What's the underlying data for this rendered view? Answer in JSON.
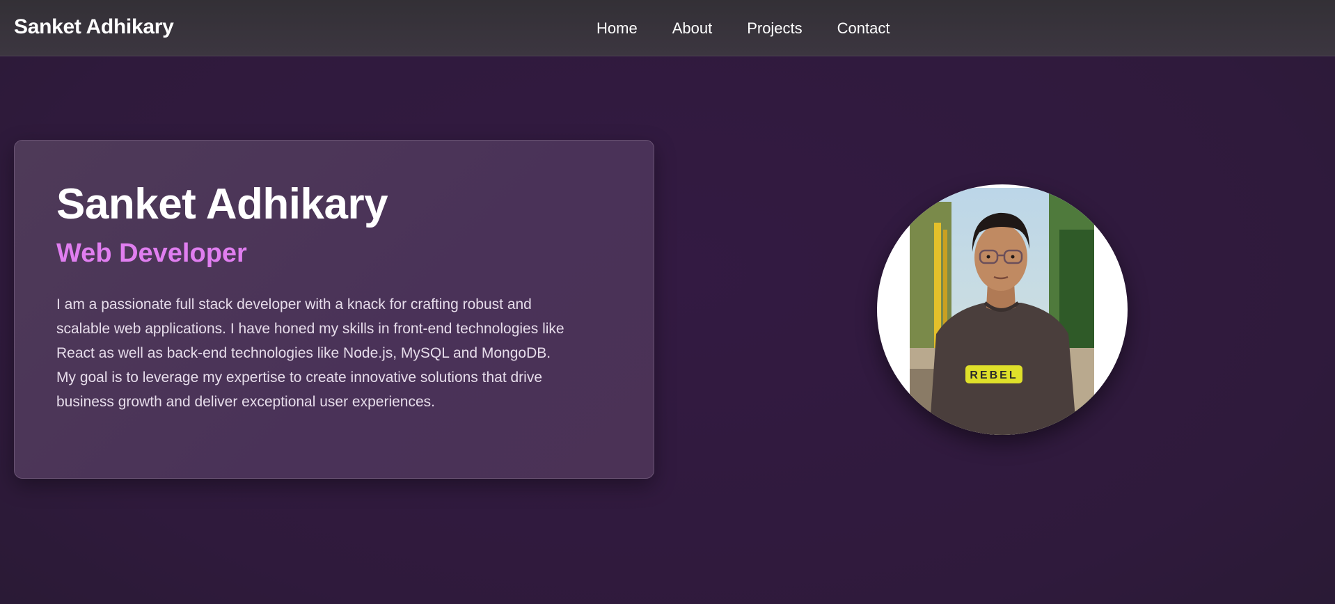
{
  "navbar": {
    "brand": "Sanket Adhikary",
    "links": [
      {
        "label": "Home"
      },
      {
        "label": "About"
      },
      {
        "label": "Projects"
      },
      {
        "label": "Contact"
      }
    ]
  },
  "hero": {
    "name": "Sanket Adhikary",
    "role": "Web Developer",
    "bio": "I am a passionate full stack developer with a knack for crafting robust and scalable web applications. I have honed my skills in front-end technologies like React as well as back-end technologies like Node.js, MySQL and MongoDB. My goal is to leverage my expertise to create innovative solutions that drive business growth and deliver exceptional user experiences.",
    "photo": {
      "shirt_text": "REBEL"
    }
  },
  "colors": {
    "accent": "#e07ef0",
    "background": "#2f1a3c",
    "card": "#4a3258"
  }
}
